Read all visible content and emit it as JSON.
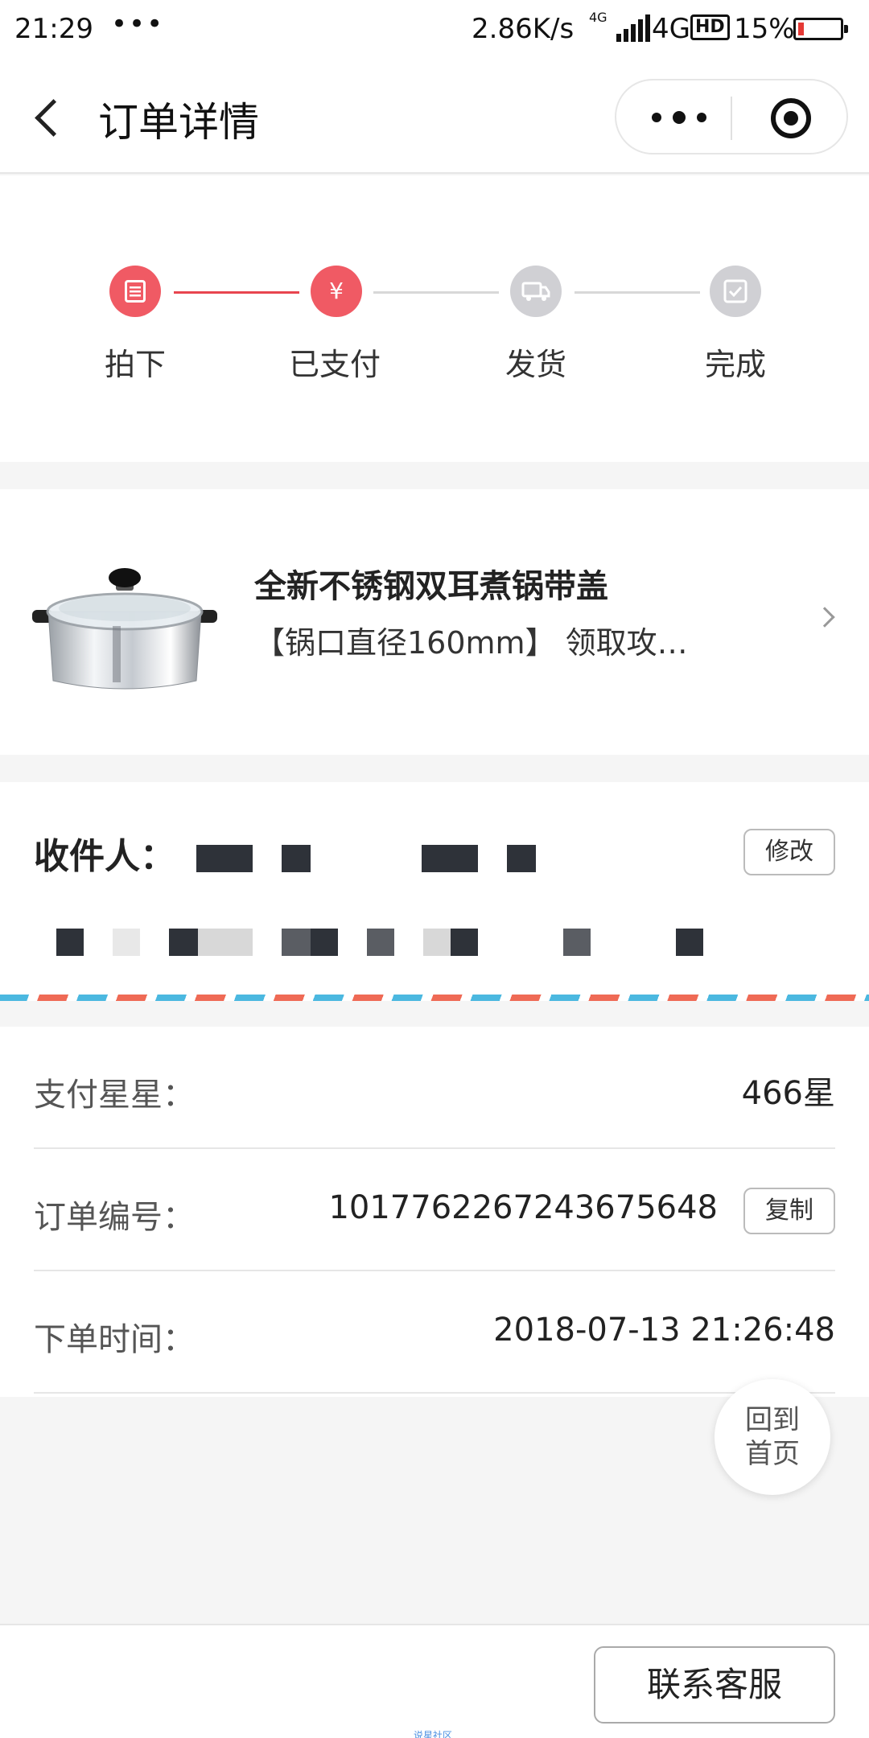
{
  "status_bar": {
    "time": "21:29",
    "dots": "•••",
    "network_speed": "2.86K/s",
    "small_network": "4G",
    "network_type": "4G",
    "hd": "HD",
    "battery": "15%"
  },
  "nav": {
    "title": "订单详情",
    "more_icon": "more-dots-icon",
    "close_icon": "record-close-icon"
  },
  "progress": {
    "steps": [
      {
        "label": "拍下",
        "state": "done",
        "icon": "list-icon"
      },
      {
        "label": "已支付",
        "state": "done",
        "icon": "yen-icon"
      },
      {
        "label": "发货",
        "state": "pending",
        "icon": "truck-icon"
      },
      {
        "label": "完成",
        "state": "pending",
        "icon": "check-icon"
      }
    ],
    "yen_symbol": "¥",
    "active_color": "#f05a64",
    "pending_color": "#d0d0d4"
  },
  "product": {
    "title": "全新不锈钢双耳煮锅带盖",
    "spec": "【锅口直径160mm】 领取攻…"
  },
  "recipient": {
    "label": "收件人：",
    "edit_label": "修改"
  },
  "info": {
    "stars_label": "支付星星：",
    "stars_value": "466星",
    "order_no_label": "订单编号：",
    "order_no_value": "1017762267243675648",
    "copy_label": "复制",
    "time_label": "下单时间：",
    "time_value": "2018-07-13 21:26:48"
  },
  "home_button": {
    "line1": "回到",
    "line2": "首页"
  },
  "bottom": {
    "contact_label": "联系客服",
    "watermark": "说星社区"
  }
}
